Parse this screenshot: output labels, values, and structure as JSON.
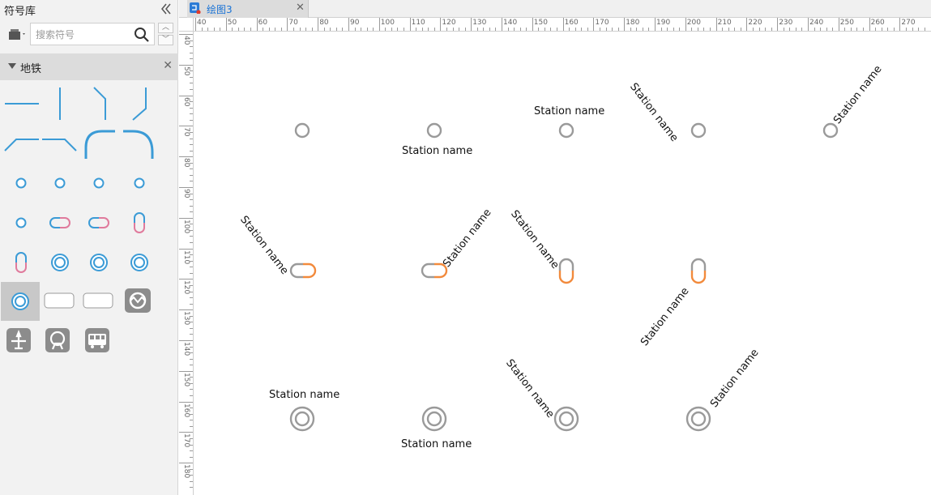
{
  "sidebar": {
    "title": "符号库",
    "search": {
      "placeholder": "搜索符号",
      "value": ""
    },
    "section": {
      "label": "地铁"
    }
  },
  "tabs": [
    {
      "label": "绘图3"
    }
  ],
  "ruler_h_labels": [
    "40",
    "50",
    "60",
    "70",
    "80",
    "90",
    "100",
    "110",
    "120",
    "130",
    "140",
    "150",
    "160",
    "170",
    "180",
    "190",
    "200",
    "210",
    "220",
    "230",
    "240",
    "250",
    "260",
    "270"
  ],
  "ruler_v_labels": [
    "40",
    "50",
    "60",
    "70",
    "80",
    "90",
    "100",
    "110",
    "120",
    "130",
    "140",
    "150",
    "160",
    "170",
    "180"
  ],
  "canvas": {
    "station_labels": [
      "Station name",
      "Station name",
      "Station name",
      "Station name",
      "Station name",
      "Station name",
      "Station name",
      "Station name",
      "Station name",
      "Station name",
      "Station name",
      "Station name"
    ]
  },
  "colors": {
    "line_blue": "#3b9bd6",
    "accent_pink": "#e07a9c",
    "station_gray": "#9a9a9a",
    "station_orange": "#f28a3c",
    "icon_gray": "#8c8c8c"
  }
}
